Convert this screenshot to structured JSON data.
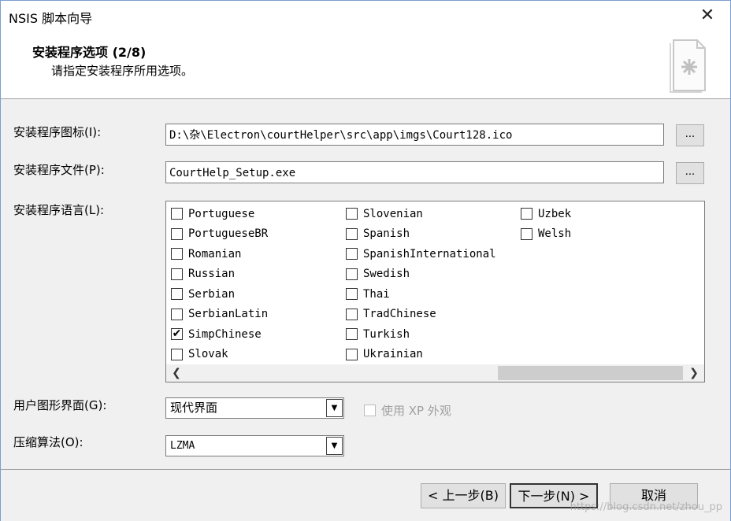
{
  "window": {
    "title": "NSIS 脚本向导",
    "close_glyph": "✕"
  },
  "header": {
    "title": "安装程序选项 (2/8)",
    "subtitle": "请指定安装程序所用选项。",
    "icon": "setup-document-icon"
  },
  "fields": {
    "icon_label": "安装程序图标(I):",
    "icon_value": "D:\\杂\\Electron\\courtHelper\\src\\app\\imgs\\Court128.ico",
    "file_label": "安装程序文件(P):",
    "file_value": "CourtHelp_Setup.exe",
    "browse_label": "...",
    "language_label": "安装程序语言(L):"
  },
  "languages": {
    "col1": [
      {
        "name": "Portuguese",
        "checked": false
      },
      {
        "name": "PortugueseBR",
        "checked": false
      },
      {
        "name": "Romanian",
        "checked": false
      },
      {
        "name": "Russian",
        "checked": false
      },
      {
        "name": "Serbian",
        "checked": false
      },
      {
        "name": "SerbianLatin",
        "checked": false
      },
      {
        "name": "SimpChinese",
        "checked": true
      },
      {
        "name": "Slovak",
        "checked": false
      }
    ],
    "col2": [
      {
        "name": "Slovenian",
        "checked": false
      },
      {
        "name": "Spanish",
        "checked": false
      },
      {
        "name": "SpanishInternational",
        "checked": false
      },
      {
        "name": "Swedish",
        "checked": false
      },
      {
        "name": "Thai",
        "checked": false
      },
      {
        "name": "TradChinese",
        "checked": false
      },
      {
        "name": "Turkish",
        "checked": false
      },
      {
        "name": "Ukrainian",
        "checked": false
      }
    ],
    "col3": [
      {
        "name": "Uzbek",
        "checked": false
      },
      {
        "name": "Welsh",
        "checked": false
      }
    ]
  },
  "gui": {
    "label": "用户图形界面(G):",
    "value": "现代界面",
    "xp_label": "使用 XP 外观",
    "xp_checked": false
  },
  "compression": {
    "label": "压缩算法(O):",
    "value": "LZMA"
  },
  "buttons": {
    "back": "< 上一步(B)",
    "next": "下一步(N) >",
    "cancel": "取消"
  },
  "watermark": "https://blog.csdn.net/zhou_pp"
}
